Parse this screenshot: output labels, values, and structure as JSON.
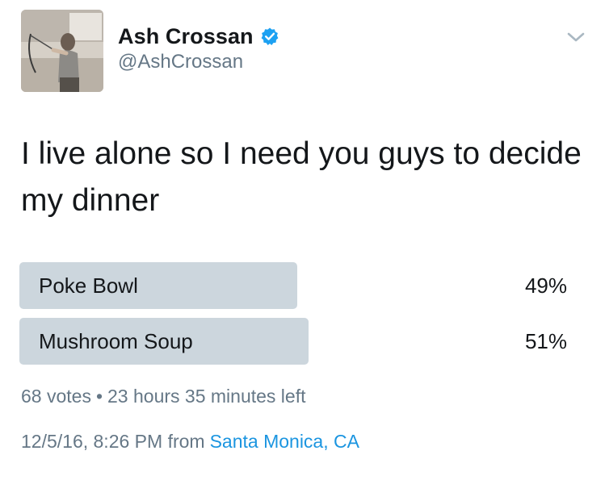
{
  "user": {
    "display_name": "Ash Crossan",
    "handle": "@AshCrossan",
    "verified": true
  },
  "icons": {
    "verified": "verified-badge-icon",
    "menu": "chevron-down-icon"
  },
  "colors": {
    "verified_blue": "#1da1f2",
    "poll_bar": "#ccd6dd",
    "secondary_text": "#657786",
    "link": "#1b95e0"
  },
  "tweet": {
    "text": "I live alone so I need you guys to decide my dinner"
  },
  "poll": {
    "options": [
      {
        "label": "Poke Bowl",
        "percent_label": "49%",
        "percent": 49
      },
      {
        "label": "Mushroom Soup",
        "percent_label": "51%",
        "percent": 51
      }
    ],
    "votes": "68 votes",
    "separator": "•",
    "time_left": "23 hours 35 minutes left"
  },
  "meta": {
    "timestamp": "12/5/16, 8:26 PM",
    "from": "from",
    "location": "Santa Monica, CA"
  }
}
